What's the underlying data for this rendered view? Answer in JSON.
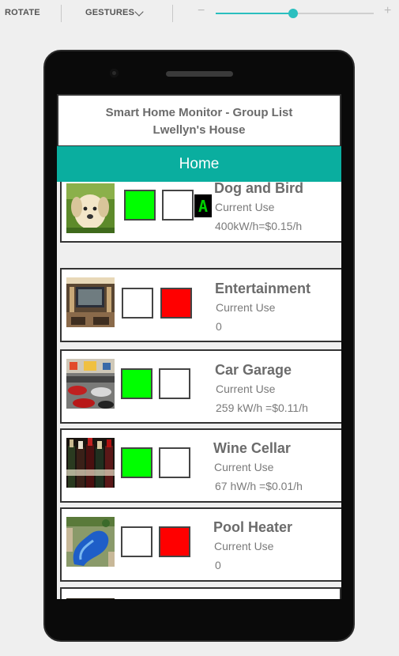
{
  "toolbar": {
    "rotate_label": "ROTATE",
    "gestures_label": "GESTURES",
    "zoom_minus": "−",
    "zoom_plus": "+",
    "zoom_level": 0.49
  },
  "app": {
    "title": "Smart Home Monitor - Group List",
    "house": "Lwellyn's House",
    "tab": "Home"
  },
  "groups": [
    {
      "name": "Dog and Bird",
      "usage_label": "Current Use",
      "usage": "400kW/h=$0.15/h",
      "on_state": "on",
      "off_state": "off",
      "badge": "A"
    },
    {
      "name": "Entertainment",
      "usage_label": "Current Use",
      "usage": "0",
      "on_state": "off",
      "off_state": "on"
    },
    {
      "name": "Car Garage",
      "usage_label": "Current Use",
      "usage": "259 kW/h =$0.11/h",
      "on_state": "on",
      "off_state": "off"
    },
    {
      "name": "Wine Cellar",
      "usage_label": "Current Use",
      "usage": "67 hW/h =$0.01/h",
      "on_state": "on",
      "off_state": "off"
    },
    {
      "name": "Pool Heater",
      "usage_label": "Current Use",
      "usage": "0",
      "on_state": "off",
      "off_state": "on"
    }
  ],
  "colors": {
    "accent": "#0aae9f",
    "on": "#00ff00",
    "off": "#ff0000",
    "slider": "#2bbfbf"
  },
  "icons": [
    "chevron-down-icon",
    "camera-icon",
    "speaker-icon",
    "puppy-photo",
    "home-theater-photo",
    "car-garage-photo",
    "wine-bottles-photo",
    "pool-photo"
  ]
}
